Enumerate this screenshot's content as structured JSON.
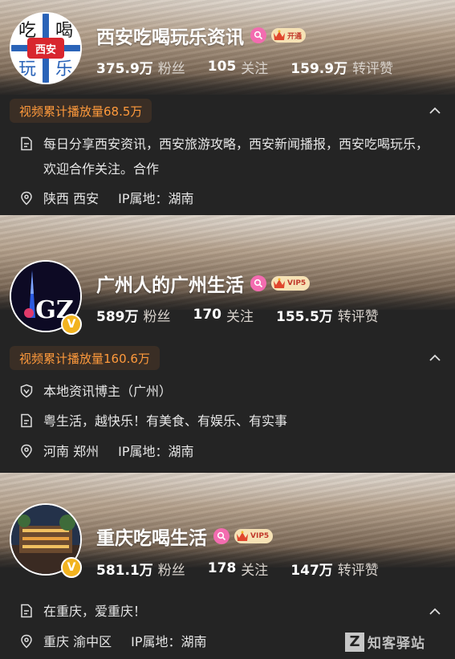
{
  "accounts": [
    {
      "name": "西安吃喝玩乐资讯",
      "avatar_text": [
        "吃",
        "喝",
        "玩",
        "乐",
        "西安"
      ],
      "vip_label": "开通",
      "stats": [
        {
          "num": "375.9万",
          "label": "粉丝"
        },
        {
          "num": "105",
          "label": "关注"
        },
        {
          "num": "159.9万",
          "label": "转评赞"
        }
      ],
      "play_count": "视频累计播放量68.5万",
      "bio": "每日分享西安资讯，西安旅游攻略，西安新闻播报，西安吃喝玩乐，欢迎合作关注。合作",
      "location": "陕西 西安",
      "ip": "IP属地：湖南"
    },
    {
      "name": "广州人的广州生活",
      "avatar_text": "GZ",
      "vip_label": "VIP5",
      "stats": [
        {
          "num": "589万",
          "label": "粉丝"
        },
        {
          "num": "170",
          "label": "关注"
        },
        {
          "num": "155.5万",
          "label": "转评赞"
        }
      ],
      "play_count": "视频累计播放量160.6万",
      "certification": "本地资讯博主（广州）",
      "bio": "粤生活，越快乐！有美食、有娱乐、有实事",
      "location": "河南 郑州",
      "ip": "IP属地：湖南"
    },
    {
      "name": "重庆吃喝生活",
      "vip_label": "VIP5",
      "stats": [
        {
          "num": "581.1万",
          "label": "粉丝"
        },
        {
          "num": "178",
          "label": "关注"
        },
        {
          "num": "147万",
          "label": "转评赞"
        }
      ],
      "bio": "在重庆，爱重庆！",
      "location": "重庆 渝中区",
      "ip": "IP属地：湖南"
    }
  ],
  "watermark": "知客驿站",
  "colors": {
    "accent": "#ff9a3c",
    "vip_bg": "#f6e2b5",
    "search_badge": "#f36cb0",
    "v_badge": "#f2b320"
  },
  "icons": [
    "search-badge-icon",
    "crown-icon",
    "chevron-up-icon",
    "document-icon",
    "location-pin-icon",
    "shield-v-icon",
    "v-badge-icon"
  ]
}
